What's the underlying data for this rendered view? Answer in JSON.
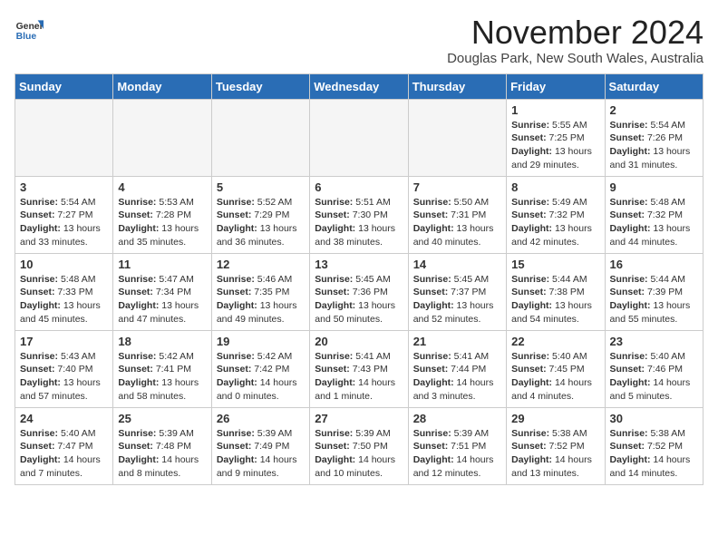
{
  "logo": {
    "general": "General",
    "blue": "Blue"
  },
  "header": {
    "month": "November 2024",
    "location": "Douglas Park, New South Wales, Australia"
  },
  "days_of_week": [
    "Sunday",
    "Monday",
    "Tuesday",
    "Wednesday",
    "Thursday",
    "Friday",
    "Saturday"
  ],
  "weeks": [
    [
      {
        "day": "",
        "info": ""
      },
      {
        "day": "",
        "info": ""
      },
      {
        "day": "",
        "info": ""
      },
      {
        "day": "",
        "info": ""
      },
      {
        "day": "",
        "info": ""
      },
      {
        "day": "1",
        "info": "Sunrise: 5:55 AM\nSunset: 7:25 PM\nDaylight: 13 hours and 29 minutes."
      },
      {
        "day": "2",
        "info": "Sunrise: 5:54 AM\nSunset: 7:26 PM\nDaylight: 13 hours and 31 minutes."
      }
    ],
    [
      {
        "day": "3",
        "info": "Sunrise: 5:54 AM\nSunset: 7:27 PM\nDaylight: 13 hours and 33 minutes."
      },
      {
        "day": "4",
        "info": "Sunrise: 5:53 AM\nSunset: 7:28 PM\nDaylight: 13 hours and 35 minutes."
      },
      {
        "day": "5",
        "info": "Sunrise: 5:52 AM\nSunset: 7:29 PM\nDaylight: 13 hours and 36 minutes."
      },
      {
        "day": "6",
        "info": "Sunrise: 5:51 AM\nSunset: 7:30 PM\nDaylight: 13 hours and 38 minutes."
      },
      {
        "day": "7",
        "info": "Sunrise: 5:50 AM\nSunset: 7:31 PM\nDaylight: 13 hours and 40 minutes."
      },
      {
        "day": "8",
        "info": "Sunrise: 5:49 AM\nSunset: 7:32 PM\nDaylight: 13 hours and 42 minutes."
      },
      {
        "day": "9",
        "info": "Sunrise: 5:48 AM\nSunset: 7:32 PM\nDaylight: 13 hours and 44 minutes."
      }
    ],
    [
      {
        "day": "10",
        "info": "Sunrise: 5:48 AM\nSunset: 7:33 PM\nDaylight: 13 hours and 45 minutes."
      },
      {
        "day": "11",
        "info": "Sunrise: 5:47 AM\nSunset: 7:34 PM\nDaylight: 13 hours and 47 minutes."
      },
      {
        "day": "12",
        "info": "Sunrise: 5:46 AM\nSunset: 7:35 PM\nDaylight: 13 hours and 49 minutes."
      },
      {
        "day": "13",
        "info": "Sunrise: 5:45 AM\nSunset: 7:36 PM\nDaylight: 13 hours and 50 minutes."
      },
      {
        "day": "14",
        "info": "Sunrise: 5:45 AM\nSunset: 7:37 PM\nDaylight: 13 hours and 52 minutes."
      },
      {
        "day": "15",
        "info": "Sunrise: 5:44 AM\nSunset: 7:38 PM\nDaylight: 13 hours and 54 minutes."
      },
      {
        "day": "16",
        "info": "Sunrise: 5:44 AM\nSunset: 7:39 PM\nDaylight: 13 hours and 55 minutes."
      }
    ],
    [
      {
        "day": "17",
        "info": "Sunrise: 5:43 AM\nSunset: 7:40 PM\nDaylight: 13 hours and 57 minutes."
      },
      {
        "day": "18",
        "info": "Sunrise: 5:42 AM\nSunset: 7:41 PM\nDaylight: 13 hours and 58 minutes."
      },
      {
        "day": "19",
        "info": "Sunrise: 5:42 AM\nSunset: 7:42 PM\nDaylight: 14 hours and 0 minutes."
      },
      {
        "day": "20",
        "info": "Sunrise: 5:41 AM\nSunset: 7:43 PM\nDaylight: 14 hours and 1 minute."
      },
      {
        "day": "21",
        "info": "Sunrise: 5:41 AM\nSunset: 7:44 PM\nDaylight: 14 hours and 3 minutes."
      },
      {
        "day": "22",
        "info": "Sunrise: 5:40 AM\nSunset: 7:45 PM\nDaylight: 14 hours and 4 minutes."
      },
      {
        "day": "23",
        "info": "Sunrise: 5:40 AM\nSunset: 7:46 PM\nDaylight: 14 hours and 5 minutes."
      }
    ],
    [
      {
        "day": "24",
        "info": "Sunrise: 5:40 AM\nSunset: 7:47 PM\nDaylight: 14 hours and 7 minutes."
      },
      {
        "day": "25",
        "info": "Sunrise: 5:39 AM\nSunset: 7:48 PM\nDaylight: 14 hours and 8 minutes."
      },
      {
        "day": "26",
        "info": "Sunrise: 5:39 AM\nSunset: 7:49 PM\nDaylight: 14 hours and 9 minutes."
      },
      {
        "day": "27",
        "info": "Sunrise: 5:39 AM\nSunset: 7:50 PM\nDaylight: 14 hours and 10 minutes."
      },
      {
        "day": "28",
        "info": "Sunrise: 5:39 AM\nSunset: 7:51 PM\nDaylight: 14 hours and 12 minutes."
      },
      {
        "day": "29",
        "info": "Sunrise: 5:38 AM\nSunset: 7:52 PM\nDaylight: 14 hours and 13 minutes."
      },
      {
        "day": "30",
        "info": "Sunrise: 5:38 AM\nSunset: 7:52 PM\nDaylight: 14 hours and 14 minutes."
      }
    ]
  ]
}
